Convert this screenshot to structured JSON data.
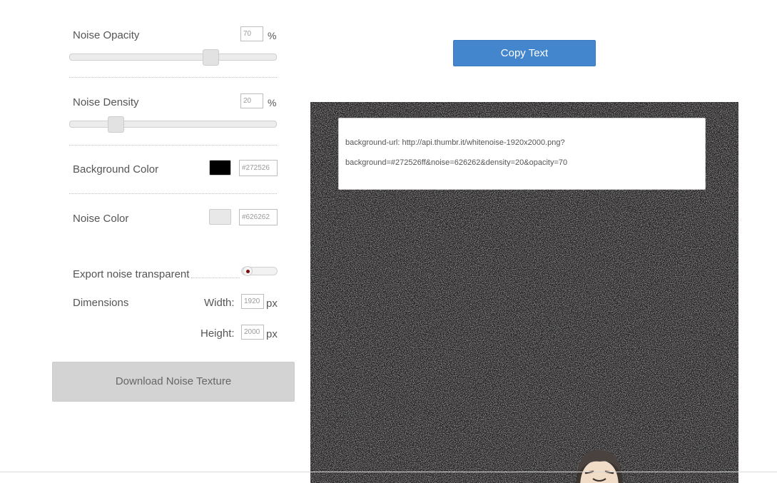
{
  "controls": {
    "noise_opacity": {
      "label": "Noise Opacity",
      "value": "70",
      "unit": "%",
      "slider_fraction": 0.7
    },
    "noise_density": {
      "label": "Noise Density",
      "value": "20",
      "unit": "%",
      "slider_fraction": 0.2
    },
    "background_color": {
      "label": "Background Color",
      "value": "#272526",
      "swatch": "#000000"
    },
    "noise_color": {
      "label": "Noise Color",
      "value": "#626262",
      "swatch": "#e8e8e8"
    },
    "export_transparent": {
      "label": "Export noise transparent",
      "enabled": false
    },
    "dimensions": {
      "label": "Dimensions",
      "width_label": "Width:",
      "width_value": "1920",
      "height_label": "Height:",
      "height_value": "2000",
      "unit": "px"
    },
    "download_label": "Download Noise Texture"
  },
  "copy_button_label": "Copy Text",
  "preview": {
    "background": "#272526",
    "code_line_1": "background-url: http://api.thumbr.it/whitenoise-1920x2000.png?",
    "code_line_2": "background=#272526ff&noise=626262&density=20&opacity=70"
  },
  "accent_color": "#4386cd",
  "icons": {
    "toggle": "toggle-switch-icon",
    "avatar": "mascot-avatar-icon"
  }
}
